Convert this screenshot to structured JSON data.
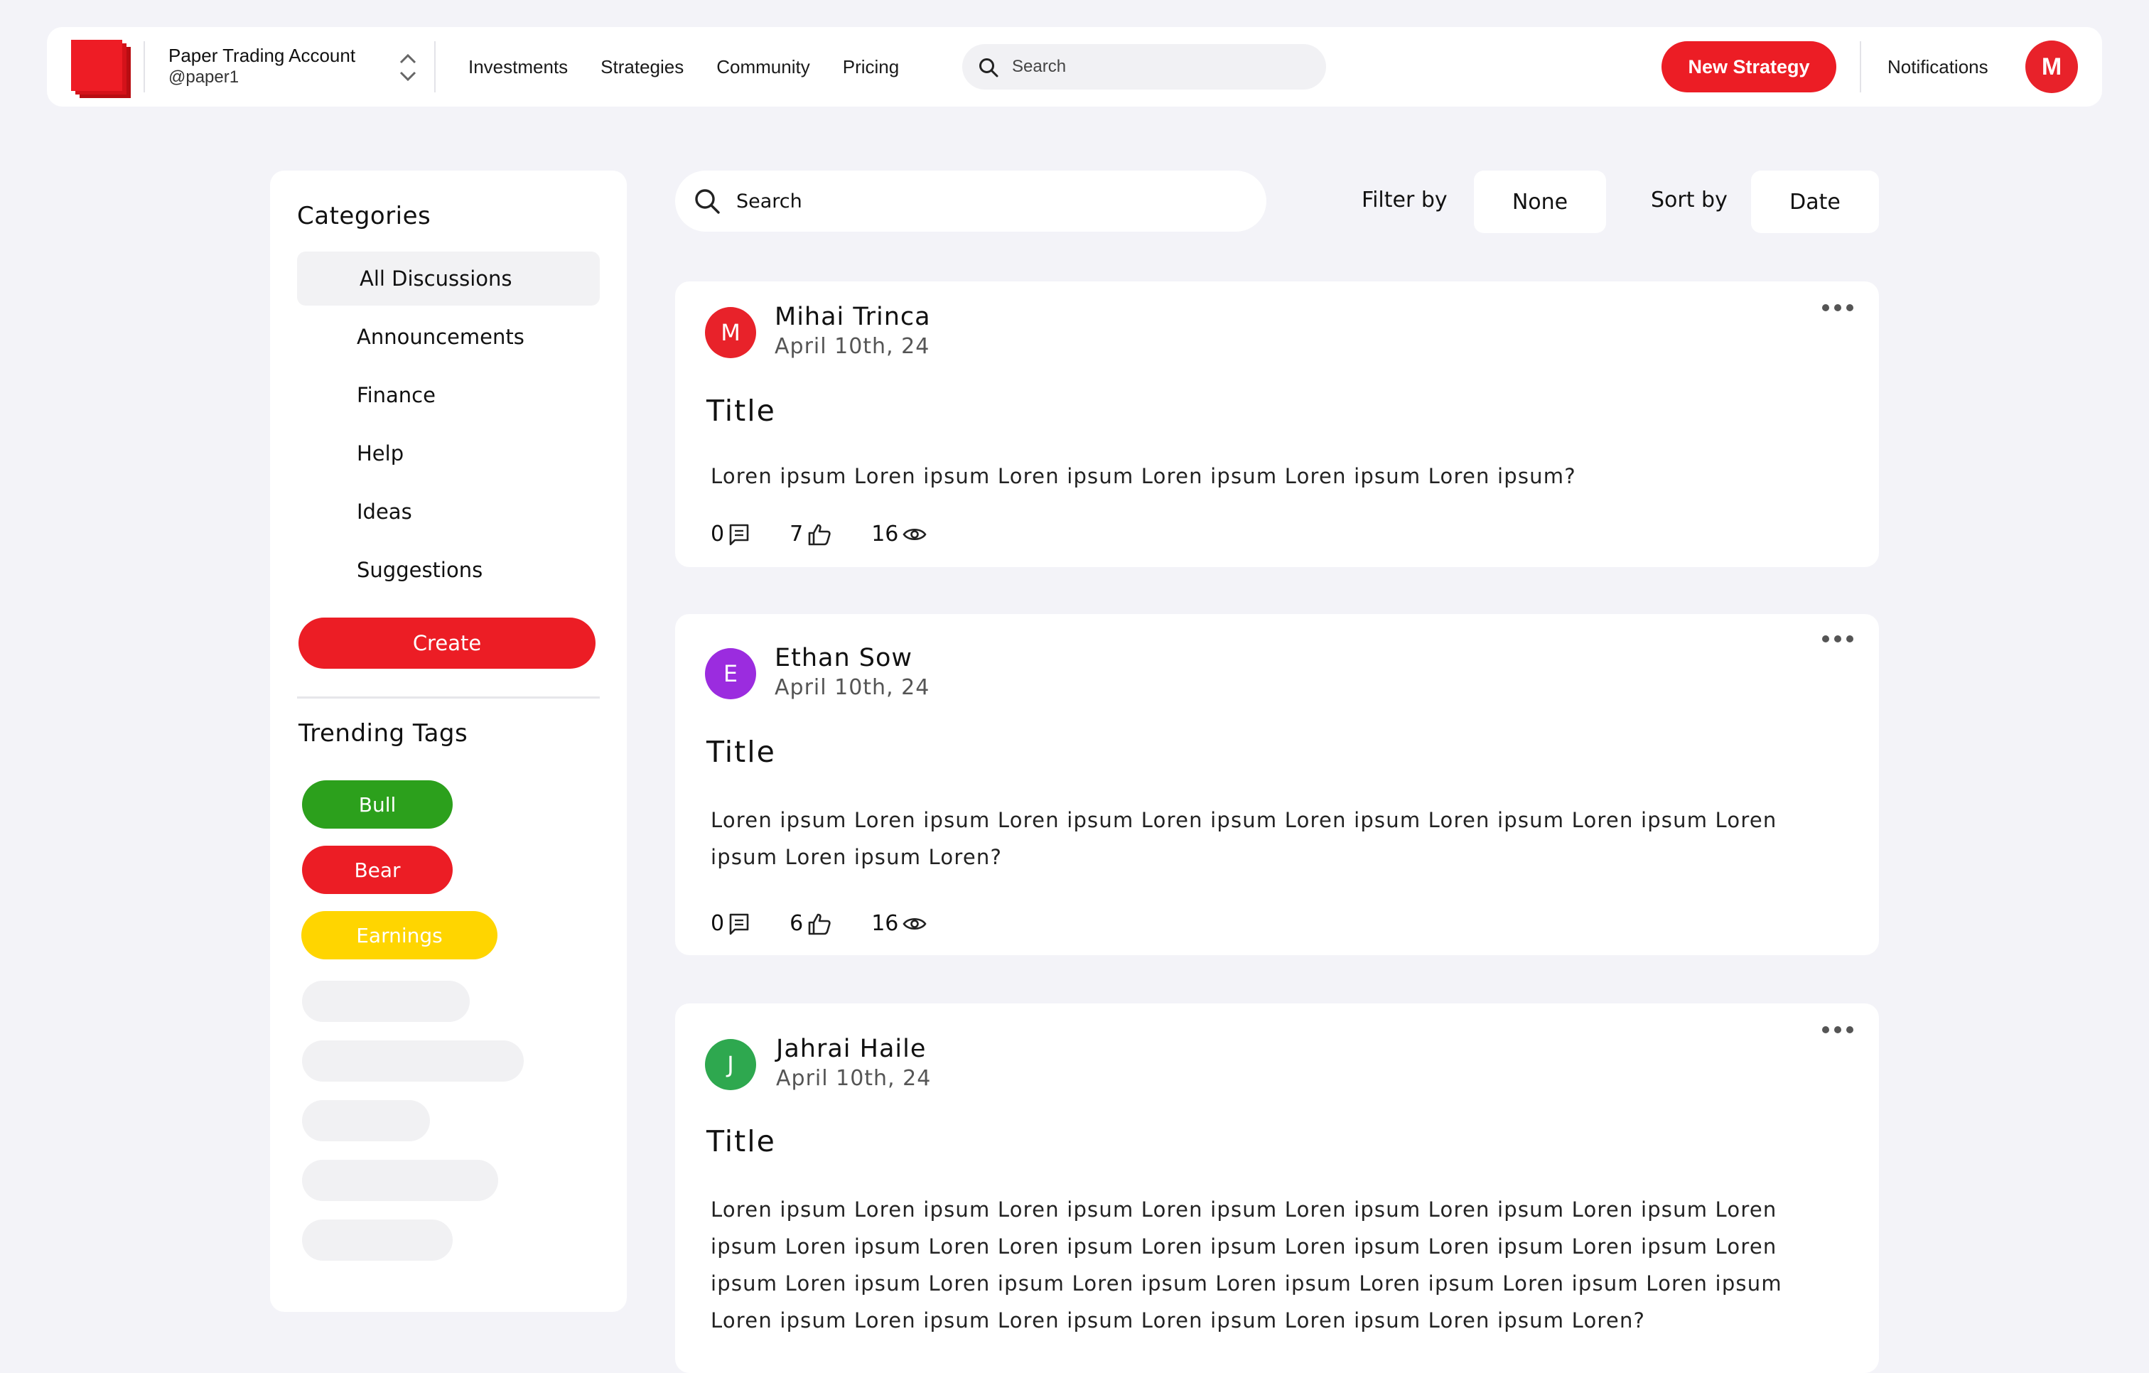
{
  "topbar": {
    "account_name": "Paper Trading Account",
    "account_handle": "@paper1",
    "nav": [
      "Investments",
      "Strategies",
      "Community",
      "Pricing"
    ],
    "search_placeholder": "Search",
    "new_strategy_label": "New Strategy",
    "notifications_label": "Notifications",
    "avatar_initial": "M",
    "brand_color": "#ec1d25"
  },
  "sidebar": {
    "categories_heading": "Categories",
    "categories": [
      "All Discussions",
      "Announcements",
      "Finance",
      "Help",
      "Ideas",
      "Suggestions"
    ],
    "active_category": "All Discussions",
    "create_label": "Create",
    "trending_heading": "Trending Tags",
    "tags": [
      {
        "label": "Bull",
        "color": "#2ca01c"
      },
      {
        "label": "Bear",
        "color": "#ec1d25"
      },
      {
        "label": "Earnings",
        "color": "#ffd500"
      }
    ]
  },
  "toolbar": {
    "search_placeholder": "Search",
    "filter_label": "Filter by",
    "filter_value": "None",
    "sort_label": "Sort by",
    "sort_value": "Date"
  },
  "posts": [
    {
      "initial": "M",
      "avatar_color": "#e8222a",
      "author": "Mihai Trinca",
      "date": "April 10th, 24",
      "title": "Title",
      "body": "Loren ipsum Loren ipsum Loren ipsum Loren ipsum Loren ipsum Loren ipsum?",
      "comments": "0",
      "likes": "7",
      "views": "16"
    },
    {
      "initial": "E",
      "avatar_color": "#9b2cdf",
      "author": "Ethan Sow",
      "date": "April 10th, 24",
      "title": "Title",
      "body": "Loren ipsum Loren ipsum Loren ipsum Loren ipsum Loren ipsum Loren ipsum Loren ipsum Loren ipsum Loren ipsum Loren?",
      "comments": "0",
      "likes": "6",
      "views": "16"
    },
    {
      "initial": "J",
      "avatar_color": "#2ea84f",
      "author": "Jahrai Haile",
      "date": "April 10th, 24",
      "title": "Title",
      "body": "Loren ipsum Loren ipsum Loren ipsum Loren ipsum Loren ipsum Loren ipsum Loren ipsum Loren ipsum Loren ipsum Loren Loren ipsum Loren ipsum Loren ipsum Loren ipsum Loren ipsum Loren ipsum Loren ipsum Loren ipsum Loren ipsum Loren ipsum Loren ipsum Loren ipsum Loren ipsum Loren ipsum Loren ipsum Loren ipsum Loren ipsum Loren ipsum Loren ipsum Loren?"
    }
  ]
}
